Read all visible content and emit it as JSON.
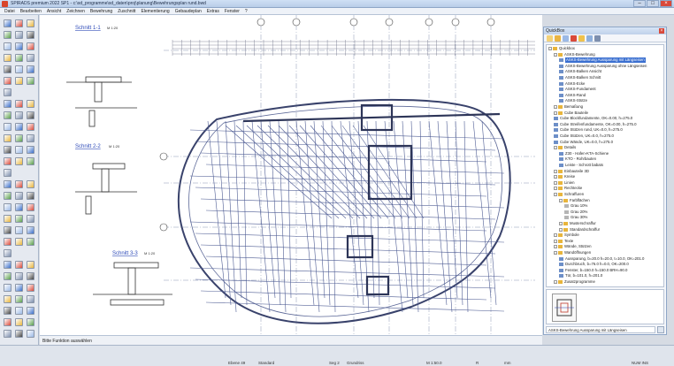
{
  "window": {
    "title": "SPIRADS premium 2022 SP1 - c:\\sd_programme\\sd_daten\\proj\\planung\\Bewehrungsplan rund.bwd"
  },
  "menu": [
    "Datei",
    "Bearbeiten",
    "Ansicht",
    "Zeichnen",
    "Bewehrung",
    "Zuschnitt",
    "Elementierung",
    "Gebaudeplan",
    "Extras",
    "Fenster",
    "?"
  ],
  "drawing": {
    "section_1": {
      "label": "Schnitt 1-1",
      "scale": "M 1:20"
    },
    "section_2": {
      "label": "Schnitt 2-2",
      "scale": "M 1:20"
    },
    "section_3": {
      "label": "Schnitt 3-3",
      "scale": "M 1:20"
    }
  },
  "hint": "Bitte Funktion auswählen",
  "status": {
    "layer": "Ebene 49",
    "view": "Standard",
    "segment": "Seg 2",
    "plan": "Grundriss",
    "scale": "M 1:50.0",
    "snap": "R",
    "units": "mm",
    "flags": "NUM   INS"
  },
  "quickbox": {
    "title": "QuickBox",
    "tree": [
      {
        "label": "Quickbox",
        "level": 0,
        "icon": "folder-icon"
      },
      {
        "label": "ASKS-Bewehrung",
        "level": 1,
        "icon": "folder-icon"
      },
      {
        "label": "ASKS-Bewehrung Aussparung mit Längseisen",
        "level": 2,
        "icon": "element-icon",
        "selected": true
      },
      {
        "label": "ASKS-Bewehrung Aussparung ohne Längseisen",
        "level": 2,
        "icon": "element-icon"
      },
      {
        "label": "ASKS-Balken Ansicht",
        "level": 2,
        "icon": "element-icon"
      },
      {
        "label": "ASKS-Balken Schnitt",
        "level": 2,
        "icon": "element-icon"
      },
      {
        "label": "ASKS-Ecke",
        "level": 2,
        "icon": "element-icon"
      },
      {
        "label": "ASKS-Fundament",
        "level": 2,
        "icon": "element-icon"
      },
      {
        "label": "ASKS-Rand",
        "level": 2,
        "icon": "element-icon"
      },
      {
        "label": "ASKS-Stütze",
        "level": 2,
        "icon": "element-icon"
      },
      {
        "label": "Bemaßung",
        "level": 1,
        "icon": "folder-icon"
      },
      {
        "label": "Cube Bauteile",
        "level": 1,
        "icon": "folder-icon"
      },
      {
        "label": "Cube Blockfundamente, OK=0.00, h=275.0",
        "level": 1,
        "icon": "element-icon"
      },
      {
        "label": "Cube Streifenfundamente, OK=0.00, h=275.0",
        "level": 1,
        "icon": "element-icon"
      },
      {
        "label": "Cube Stützen rund, UK=0.0, h=275.0",
        "level": 1,
        "icon": "element-icon"
      },
      {
        "label": "Cube Stützen, UK=0.0, h=275.0",
        "level": 1,
        "icon": "element-icon"
      },
      {
        "label": "Cube Wände, UK=0.0, h=275.0",
        "level": 1,
        "icon": "element-icon"
      },
      {
        "label": "Details",
        "level": 1,
        "icon": "folder-icon"
      },
      {
        "label": "Z30 - Hafen-KTA-Schiene",
        "level": 2,
        "icon": "element-icon"
      },
      {
        "label": "KTO - Rohrbauten",
        "level": 2,
        "icon": "element-icon"
      },
      {
        "label": "Leiste - Schrott babats",
        "level": 2,
        "icon": "element-icon"
      },
      {
        "label": "Einbauteile 3D",
        "level": 1,
        "icon": "folder-icon"
      },
      {
        "label": "Kreise",
        "level": 1,
        "icon": "folder-icon"
      },
      {
        "label": "Linien",
        "level": 1,
        "icon": "folder-icon"
      },
      {
        "label": "Rechtecke",
        "level": 1,
        "icon": "folder-icon"
      },
      {
        "label": "Schraffuren",
        "level": 1,
        "icon": "folder-icon"
      },
      {
        "label": "Farbflächen",
        "level": 2,
        "icon": "folder-icon"
      },
      {
        "label": "Grau 10%",
        "level": 3,
        "icon": "swatch-icon"
      },
      {
        "label": "Grau 20%",
        "level": 3,
        "icon": "swatch-icon"
      },
      {
        "label": "Grau 30%",
        "level": 3,
        "icon": "swatch-icon"
      },
      {
        "label": "Musterschraffur",
        "level": 2,
        "icon": "folder-icon"
      },
      {
        "label": "Standardschraffur",
        "level": 2,
        "icon": "folder-icon"
      },
      {
        "label": "Symbole",
        "level": 1,
        "icon": "folder-icon"
      },
      {
        "label": "Texte",
        "level": 1,
        "icon": "folder-icon"
      },
      {
        "label": "Wände, Stützen",
        "level": 1,
        "icon": "folder-icon"
      },
      {
        "label": "Wandöffnungen",
        "level": 1,
        "icon": "folder-icon"
      },
      {
        "label": "Aussparung, b=20.0 h=20.0, t=10.0, OK=201.0",
        "level": 2,
        "icon": "element-icon"
      },
      {
        "label": "Durchbruch, b=76.0 h=0.0, OK=200.0",
        "level": 2,
        "icon": "element-icon"
      },
      {
        "label": "Fenster, b=150.0 h=150.0 BRH=90.0",
        "level": 2,
        "icon": "element-icon"
      },
      {
        "label": "Tür, b=101.0, h=201.0",
        "level": 2,
        "icon": "element-icon"
      },
      {
        "label": "Zusatzprogramme",
        "level": 1,
        "icon": "folder-icon"
      }
    ],
    "footer": "ASKS-Bewehrung Aussparung mit Längseisen"
  }
}
